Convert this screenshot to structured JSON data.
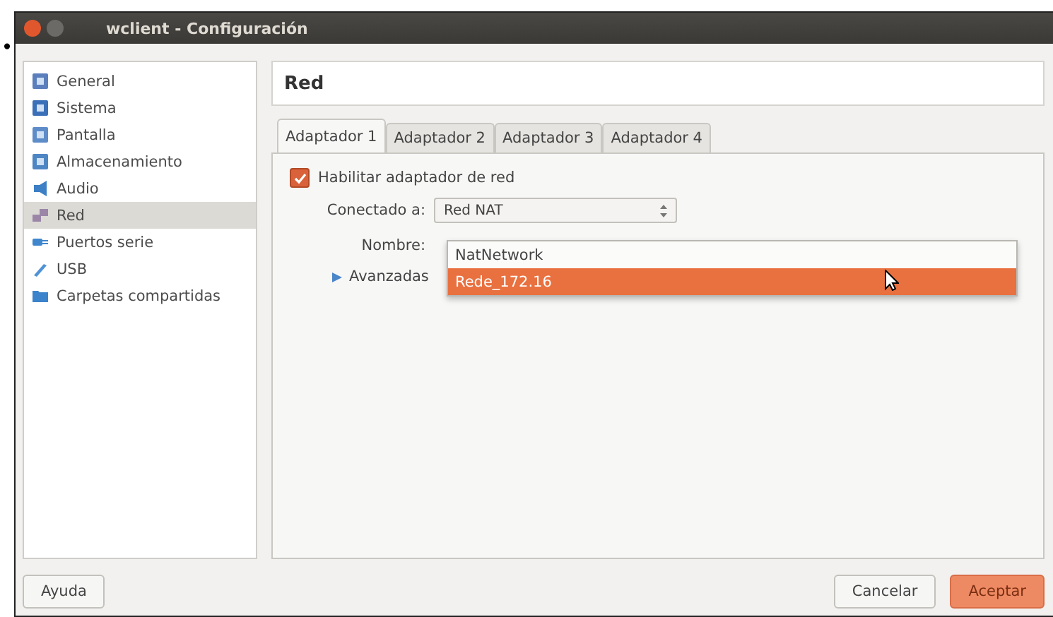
{
  "bullet": "•",
  "window": {
    "title": "wclient - Configuración"
  },
  "sidebar": {
    "items": [
      {
        "label": "General",
        "kind": "general",
        "selected": false
      },
      {
        "label": "Sistema",
        "kind": "system",
        "selected": false
      },
      {
        "label": "Pantalla",
        "kind": "display",
        "selected": false
      },
      {
        "label": "Almacenamiento",
        "kind": "storage",
        "selected": false
      },
      {
        "label": "Audio",
        "kind": "audio",
        "selected": false
      },
      {
        "label": "Red",
        "kind": "network",
        "selected": true
      },
      {
        "label": "Puertos serie",
        "kind": "serial",
        "selected": false
      },
      {
        "label": "USB",
        "kind": "usb",
        "selected": false
      },
      {
        "label": "Carpetas compartidas",
        "kind": "folder",
        "selected": false
      }
    ]
  },
  "page_title": "Red",
  "tabs": [
    {
      "label": "Adaptador 1",
      "selected": true
    },
    {
      "label": "Adaptador 2",
      "selected": false
    },
    {
      "label": "Adaptador 3",
      "selected": false
    },
    {
      "label": "Adaptador 4",
      "selected": false
    }
  ],
  "enable": {
    "label": "Habilitar adaptador de red",
    "checked": true
  },
  "connected": {
    "label": "Conectado a:",
    "value": "Red NAT"
  },
  "name": {
    "label": "Nombre:",
    "options": [
      {
        "label": "NatNetwork",
        "selected": false
      },
      {
        "label": "Rede_172.16",
        "selected": true
      }
    ]
  },
  "advanced": {
    "label": "Avanzadas",
    "expanded": false
  },
  "buttons": [
    {
      "label": "Ayuda",
      "kind": "help"
    },
    {
      "label": "Cancelar",
      "kind": "cancel"
    },
    {
      "label": "Aceptar",
      "kind": "accept"
    }
  ]
}
